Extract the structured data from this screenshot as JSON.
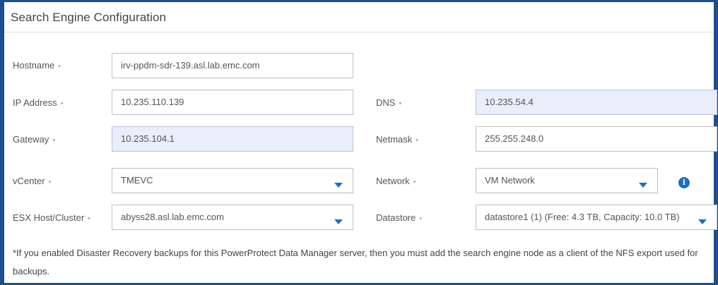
{
  "panel": {
    "title": "Search Engine Configuration"
  },
  "required_marker": "•",
  "fields": {
    "hostname": {
      "label": "Hostname",
      "value": "irv-ppdm-sdr-139.asl.lab.emc.com"
    },
    "ip_address": {
      "label": "IP Address",
      "value": "10.235.110.139"
    },
    "dns": {
      "label": "DNS",
      "value": "10.235.54.4"
    },
    "gateway": {
      "label": "Gateway",
      "value": "10.235.104.1"
    },
    "netmask": {
      "label": "Netmask",
      "value": "255.255.248.0"
    },
    "vcenter": {
      "label": "vCenter",
      "value": "TMEVC"
    },
    "network": {
      "label": "Network",
      "value": "VM Network"
    },
    "esx_host": {
      "label": "ESX Host/Cluster",
      "value": "abyss28.asl.lab.emc.com"
    },
    "datastore": {
      "label": "Datastore",
      "value": "datastore1 (1) (Free: 4.3 TB, Capacity: 10.0 TB)"
    }
  },
  "footnote": "*If you enabled Disaster Recovery backups for this PowerProtect Data Manager server, then you must add the search engine node as a client of the NFS export used for backups.",
  "icons": {
    "dropdown": "chevron-down-icon",
    "info": "info-icon"
  },
  "colors": {
    "border_accent": "#1c4f8c",
    "filled_field_bg": "#e9eefa",
    "accent_blue": "#1b6ec2"
  }
}
